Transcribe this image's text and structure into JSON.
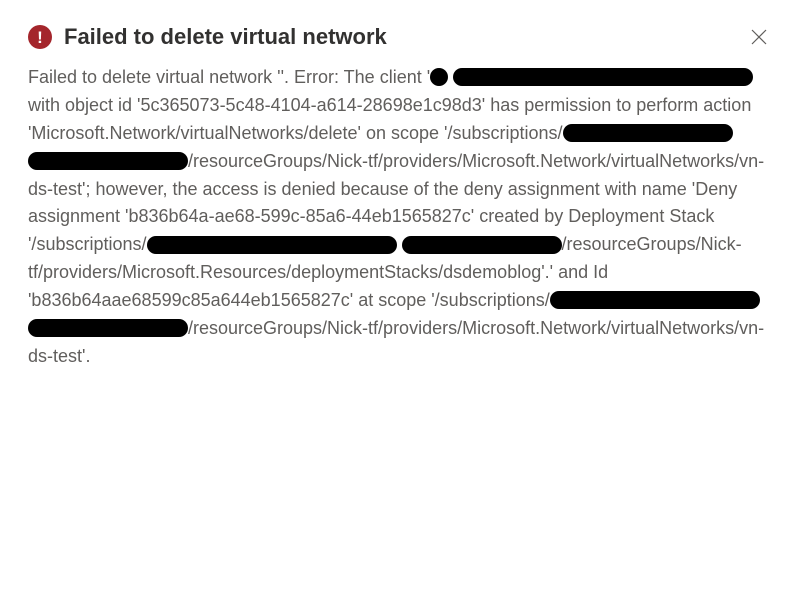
{
  "dialog": {
    "title": "Failed to delete virtual network",
    "close_aria": "Close",
    "body": {
      "seg01": "Failed to delete virtual network ''. Error: The client '",
      "seg02": " with object id '5c365073-5c48-4104-a614-28698e1c98d3' has permission to perform action 'Microsoft.Network/virtualNetworks/delete' on scope '/subscriptions/",
      "seg03": "/resourceGroups/Nick-tf/providers/Microsoft.Network/virtualNetworks/vn-ds-test'; however, the access is denied because of the deny assignment with name 'Deny assignment 'b836b64a-ae68-599c-85a6-44eb1565827c' created by Deployment Stack '/subscriptions/",
      "seg04": "/resourceGroups/Nick-tf/providers/Microsoft.Resources/deploymentStacks/dsdemoblog'.' and Id 'b836b64aae68599c85a644eb1565827c' at scope '/subscriptions/",
      "seg05": "/resourceGroups/Nick-tf/providers/Microsoft.Network/virtualNetworks/vn-ds-test'."
    }
  }
}
